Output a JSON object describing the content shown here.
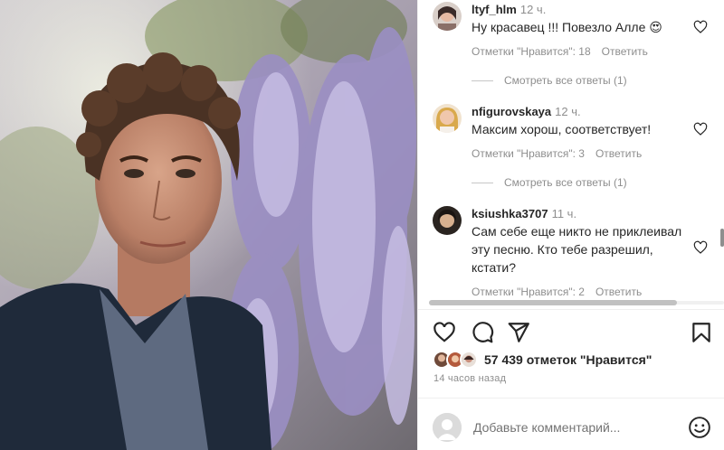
{
  "comments": [
    {
      "username": "ltyf_hlm",
      "time": "12 ч.",
      "text": "Ну красавец !!! Повезло Алле 😍",
      "likes_label": "Отметки \"Нравится\": 18",
      "reply_label": "Ответить"
    },
    {
      "username": "nfigurovskaya",
      "time": "12 ч.",
      "text": "Максим хорош, соответствует!",
      "likes_label": "Отметки \"Нравится\": 3",
      "reply_label": "Ответить"
    },
    {
      "username": "ksiushka3707",
      "time": "11 ч.",
      "text": "Сам себе еще никто не приклеивал эту песню. Кто тебе разрешил, кстати?",
      "likes_label": "Отметки \"Нравится\": 2",
      "reply_label": "Ответить"
    }
  ],
  "view_replies": [
    "Смотреть все ответы (1)",
    "Смотреть все ответы (1)"
  ],
  "post": {
    "likes_text": "57 439 отметок \"Нравится\"",
    "posted_ago": "14 часов назад"
  },
  "add_comment": {
    "placeholder": "Добавьте комментарий..."
  },
  "icons": {
    "like": "heart-icon",
    "comment": "comment-bubble-icon",
    "share": "paper-plane-icon",
    "save": "bookmark-icon",
    "emoji": "smiley-icon"
  },
  "colors": {
    "text": "#262626",
    "secondary": "#8e8e8e",
    "divider": "#efefef"
  }
}
